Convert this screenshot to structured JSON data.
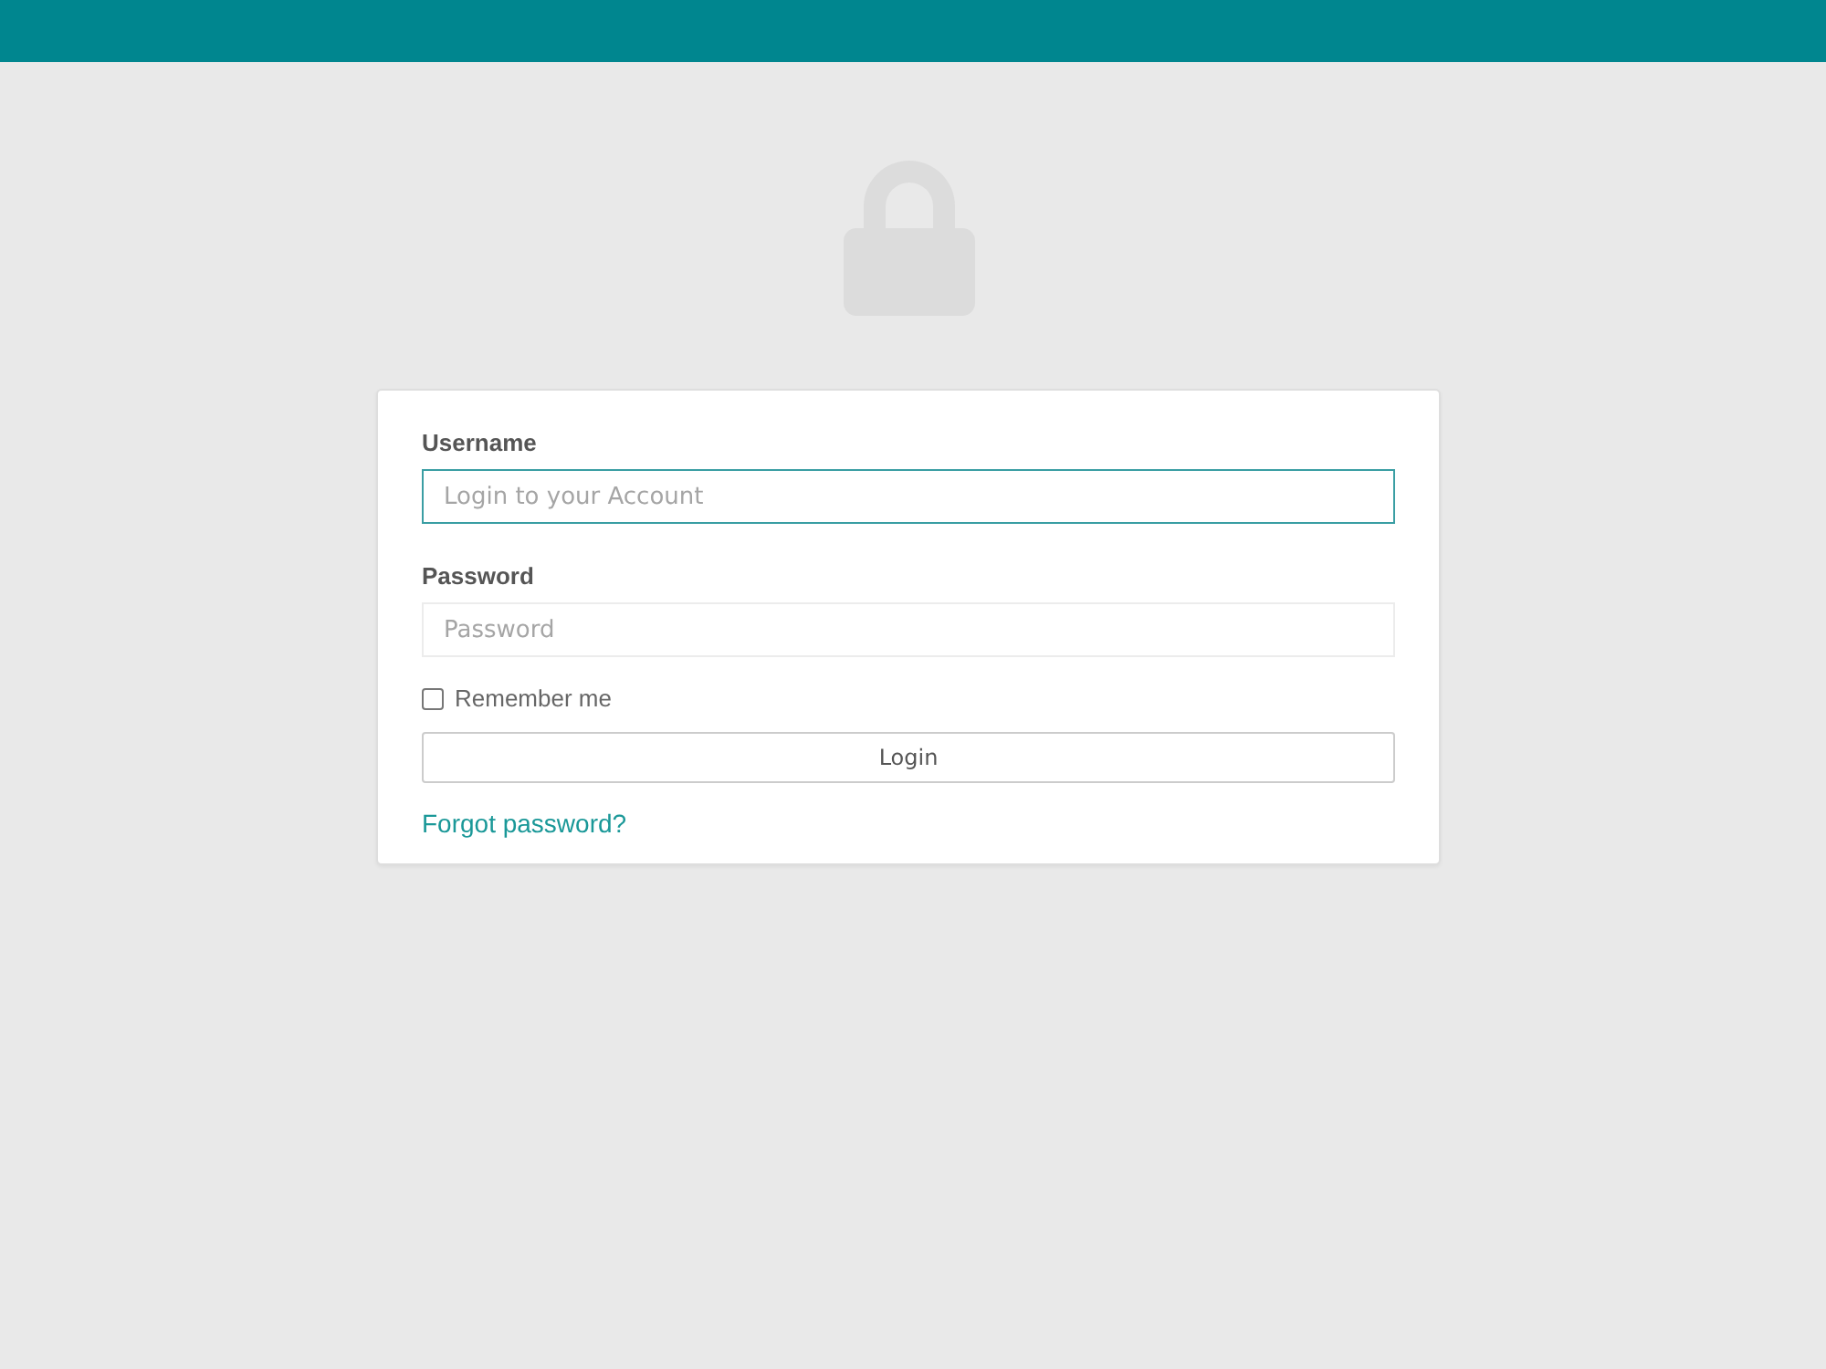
{
  "form": {
    "fields": [
      {
        "label": "Username",
        "placeholder": "Login to your Account",
        "focused": true
      },
      {
        "label": "Password",
        "placeholder": "Password",
        "focused": false
      }
    ],
    "remember": {
      "label": "Remember me",
      "checked": false
    },
    "submit": {
      "label": "Login"
    },
    "forgot_link": {
      "label": "Forgot password?"
    }
  }
}
